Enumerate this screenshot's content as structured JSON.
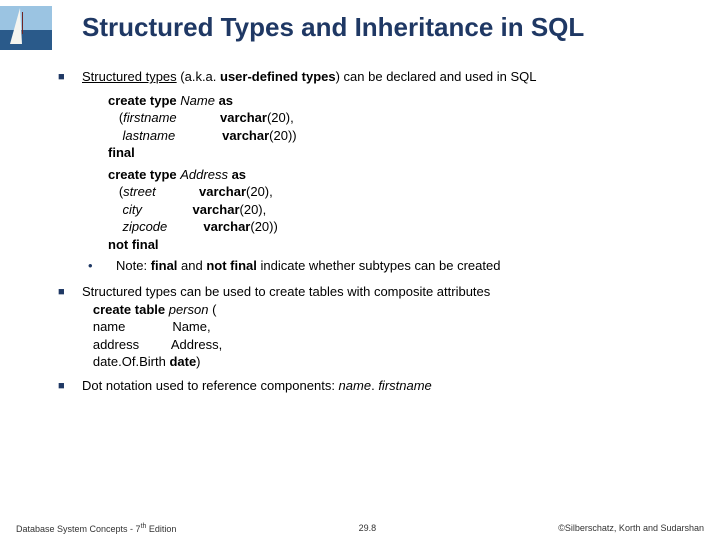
{
  "title": "Structured Types and Inheritance in SQL",
  "bullet1": {
    "pre": "Structured types",
    "mid": " (a.k.a. ",
    "mid2": "user-defined types",
    "post": ") can be declared and used in SQL"
  },
  "code1": {
    "l1a": "create type ",
    "l1b": "Name ",
    "l1c": "as",
    "l2a": "   (",
    "l2b": "firstname",
    "l2c": "            ",
    "l2d": "varchar",
    "l2e": "(20),",
    "l3a": "    ",
    "l3b": "lastname ",
    "l3c": "            ",
    "l3d": "varchar",
    "l3e": "(20))",
    "l4": "final"
  },
  "code2": {
    "l1a": "create type ",
    "l1b": "Address ",
    "l1c": "as",
    "l2a": "   (",
    "l2b": "street",
    "l2c": "            ",
    "l2d": "varchar",
    "l2e": "(20),",
    "l3a": "    ",
    "l3b": "city  ",
    "l3c": "            ",
    "l3d": "varchar",
    "l3e": "(20),",
    "l4a": "    ",
    "l4b": "zipcode",
    "l4c": "          ",
    "l4d": "varchar",
    "l4e": "(20))",
    "l5": "not final"
  },
  "note": {
    "pre": "Note: ",
    "b1": "final",
    "mid": " and ",
    "b2": "not final ",
    "post": " indicate whether subtypes can be created"
  },
  "bullet2": "Structured types can be used to create tables with composite attributes",
  "code3": {
    "l1a": "   create table ",
    "l1b": "person ",
    "l1c": "(",
    "l2a": "   name",
    "l2b": "             Name,",
    "l3a": "   address",
    "l3b": "         Address,",
    "l4a": "   date.Of.Birth ",
    "l4b": "date",
    "l4c": ")"
  },
  "bullet3": {
    "pre": "Dot notation used to reference components: ",
    "it": "name",
    "mid": ". ",
    "it2": "firstname"
  },
  "footer": {
    "left_a": "Database System Concepts - 7",
    "left_b": " Edition",
    "center": "29.8",
    "right": "©Silberschatz, Korth and Sudarshan"
  }
}
